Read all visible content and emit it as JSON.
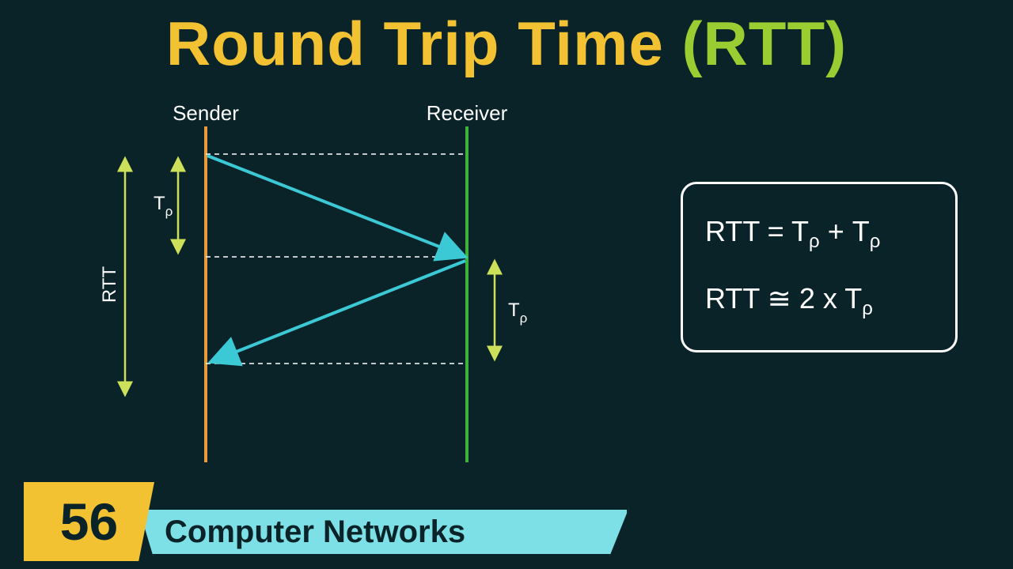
{
  "title": {
    "main": "Round Trip Time ",
    "paren": "(RTT)"
  },
  "diagram": {
    "sender_label": "Sender",
    "receiver_label": "Receiver",
    "rtt_label": "RTT",
    "tp_label_1": "T",
    "tp_sub_1": "ρ",
    "tp_label_2": "T",
    "tp_sub_2": "ρ"
  },
  "formula": {
    "line1_lhs": "RTT = T",
    "line1_sub1": "ρ",
    "line1_plus": "+ T",
    "line1_sub2": "ρ",
    "line2_lhs": "RTT ≅ 2 x T",
    "line2_sub": "ρ"
  },
  "footer": {
    "number": "56",
    "text": "Computer Networks"
  }
}
